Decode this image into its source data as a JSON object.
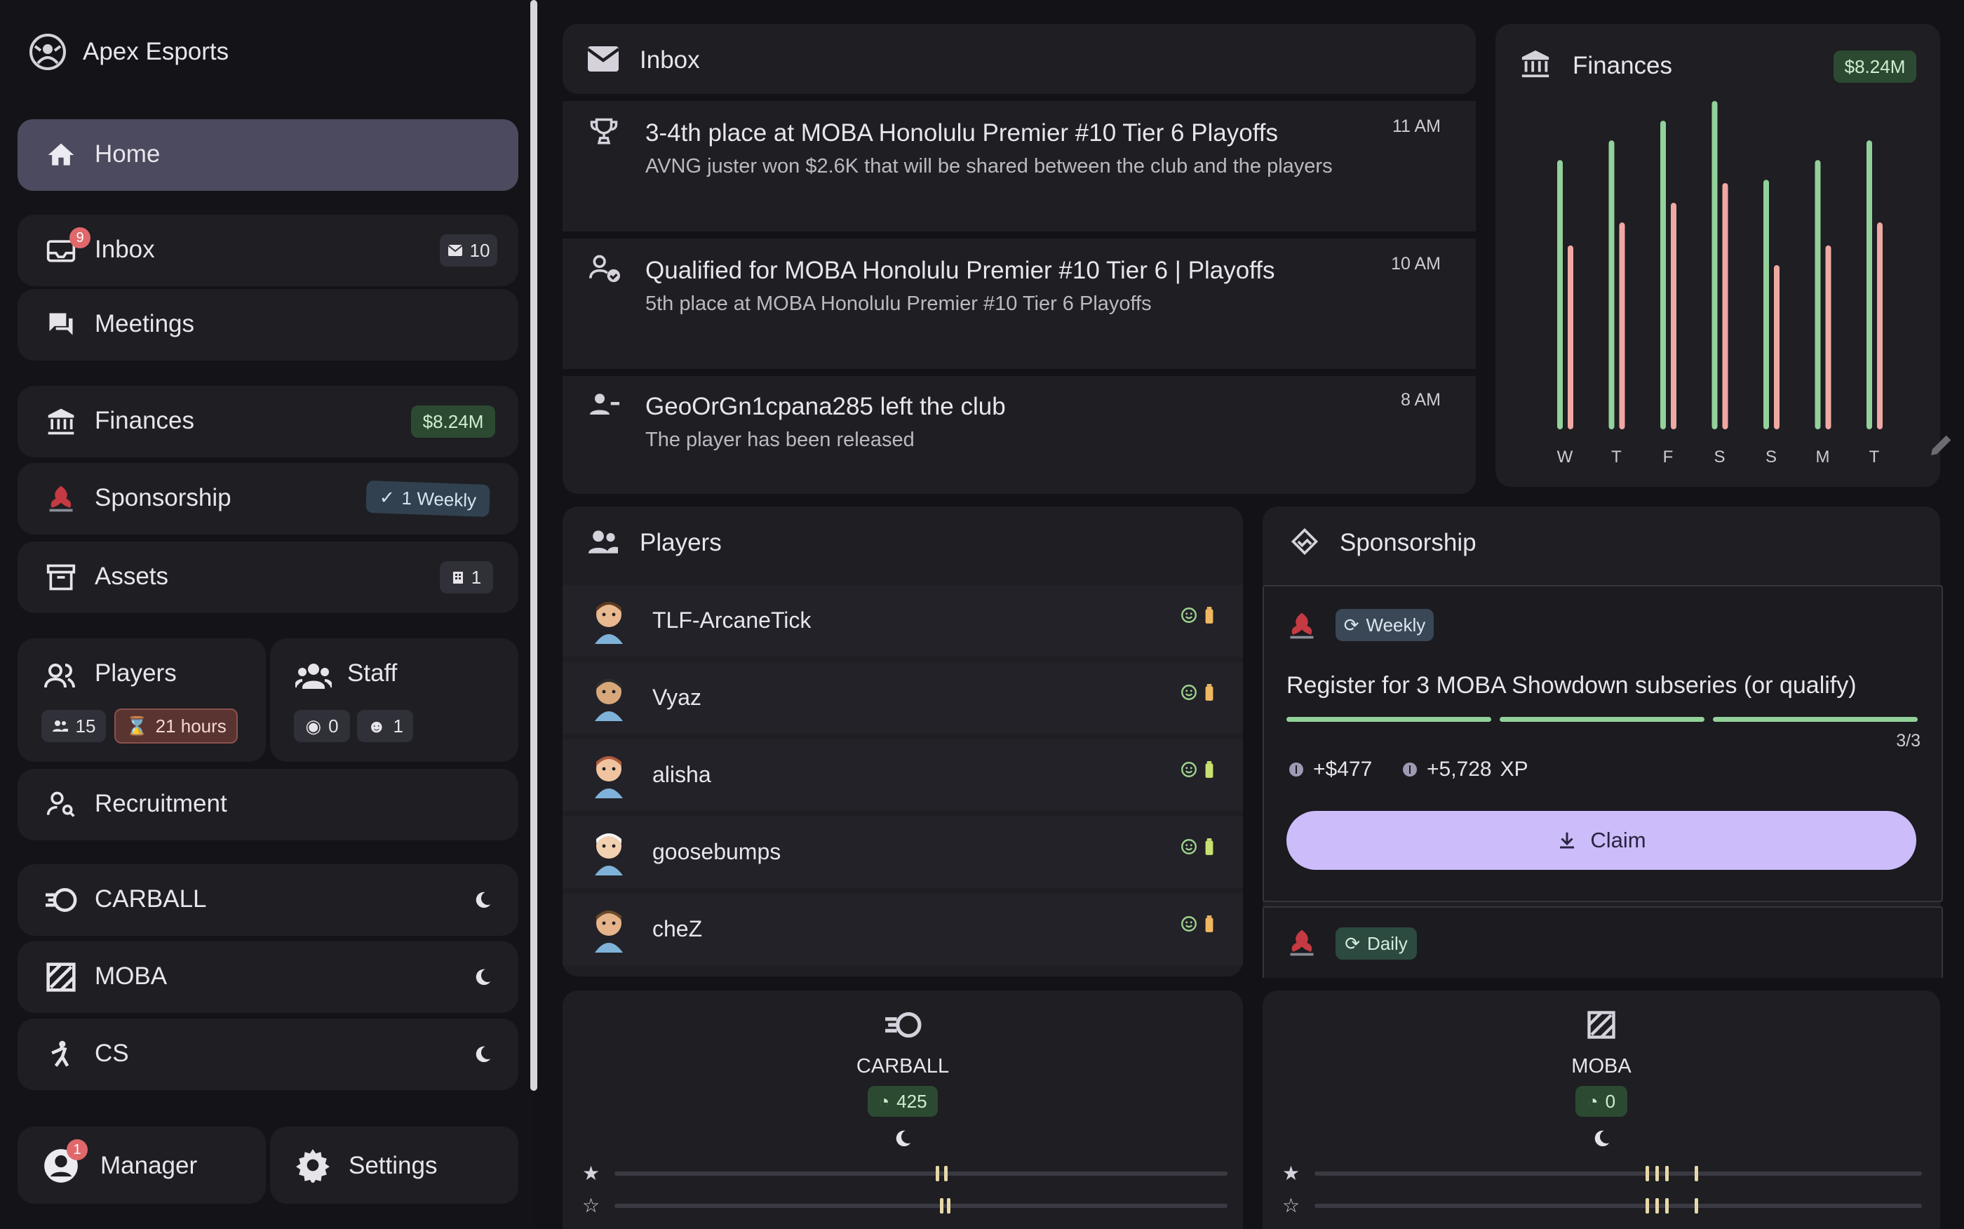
{
  "app": {
    "title": "Apex Esports"
  },
  "sidebar": {
    "home": "Home",
    "inbox": {
      "label": "Inbox",
      "notif": "9",
      "count": "10"
    },
    "meetings": "Meetings",
    "finances": {
      "label": "Finances",
      "badge": "$8.24M"
    },
    "sponsorship": {
      "label": "Sponsorship",
      "badge": "1 Weekly"
    },
    "assets": {
      "label": "Assets",
      "badge": "1"
    },
    "players": {
      "label": "Players",
      "count": "15",
      "time": "21 hours"
    },
    "staff": {
      "label": "Staff",
      "a": "0",
      "b": "1"
    },
    "recruitment": "Recruitment",
    "games": [
      {
        "label": "CARBALL"
      },
      {
        "label": "MOBA"
      },
      {
        "label": "CS"
      }
    ],
    "manager": {
      "label": "Manager",
      "notif": "1"
    },
    "settings": "Settings"
  },
  "inbox": {
    "title": "Inbox",
    "items": [
      {
        "title": "3-4th place at MOBA Honolulu Premier #10 Tier 6 Playoffs",
        "sub": "AVNG juster won $2.6K that will be shared between the club and the players",
        "time": "11 AM"
      },
      {
        "title": "Qualified for MOBA Honolulu Premier #10 Tier 6 | Playoffs",
        "sub": "5th place at MOBA Honolulu Premier #10 Tier 6 Playoffs",
        "time": "10 AM"
      },
      {
        "title": "GeoOrGn1cpana285 left the club",
        "sub": "The player has been released",
        "time": "8 AM"
      }
    ]
  },
  "finances": {
    "title": "Finances",
    "badge": "$8.24M",
    "colors": {
      "income": "#93d19a",
      "expense": "#f0a8a2"
    }
  },
  "chart_data": {
    "type": "bar",
    "categories": [
      "W",
      "T",
      "F",
      "S",
      "S",
      "M",
      "T"
    ],
    "series": [
      {
        "values": [
          0.82,
          0.88,
          0.94,
          1.0,
          0.76,
          0.82,
          0.88
        ]
      },
      {
        "values": [
          0.56,
          0.63,
          0.69,
          0.75,
          0.5,
          0.56,
          0.63
        ]
      }
    ]
  },
  "players": {
    "title": "Players",
    "list": [
      {
        "name": "TLF-ArcaneTick",
        "battery": "#f0b860"
      },
      {
        "name": "Vyaz",
        "battery": "#f0b860"
      },
      {
        "name": "alisha",
        "battery": "#c8e070"
      },
      {
        "name": "goosebumps",
        "battery": "#c8e070"
      },
      {
        "name": "cheZ",
        "battery": "#f0b860"
      }
    ]
  },
  "sponsorship": {
    "title": "Sponsorship",
    "weekly": {
      "tag": "Weekly",
      "task": "Register for 3 MOBA Showdown subseries (or qualify)",
      "progress": "3/3",
      "reward_money": "+$477",
      "reward_xp": "+5,728",
      "xp_unit": "XP",
      "claim": "Claim"
    },
    "daily": {
      "tag": "Daily"
    }
  },
  "teams": [
    {
      "name": "CARBALL",
      "rating": "425"
    },
    {
      "name": "MOBA",
      "rating": "0"
    }
  ]
}
